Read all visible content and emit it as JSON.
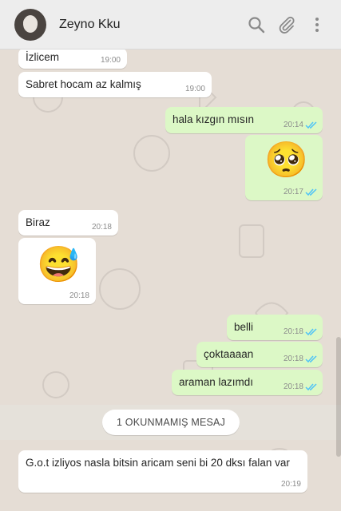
{
  "header": {
    "contact_name": "Zeyno Kku",
    "icons": [
      "search-icon",
      "paperclip-icon",
      "more-vert-icon"
    ]
  },
  "messages": [
    {
      "dir": "in",
      "text": "İzlicem",
      "time": "19:00"
    },
    {
      "dir": "in",
      "text": "Sabret hocam az kalmış",
      "time": "19:00"
    },
    {
      "dir": "out",
      "text": "hala kızgın mısın",
      "time": "20:14",
      "read": true
    },
    {
      "dir": "out",
      "emoji": "🥺",
      "time": "20:17",
      "read": true
    },
    {
      "dir": "in",
      "text": "Biraz",
      "time": "20:18"
    },
    {
      "dir": "in",
      "emoji": "😅",
      "time": "20:18"
    },
    {
      "dir": "out",
      "text": "belli",
      "time": "20:18",
      "read": true
    },
    {
      "dir": "out",
      "text": "çoktaaaan",
      "time": "20:18",
      "read": true
    },
    {
      "dir": "out",
      "text": "araman lazımdı",
      "time": "20:18",
      "read": true
    },
    {
      "dir": "in",
      "text": "G.o.t izliyos nasla bitsin aricam seni bi 20 dksı falan var",
      "time": "20:19"
    }
  ],
  "unread": {
    "label": "1 OKUNMAMIŞ MESAJ"
  },
  "colors": {
    "incoming": "#ffffff",
    "outgoing": "#dcf8c6",
    "read_ticks": "#4fc3f7",
    "background": "#e5ddd5"
  }
}
